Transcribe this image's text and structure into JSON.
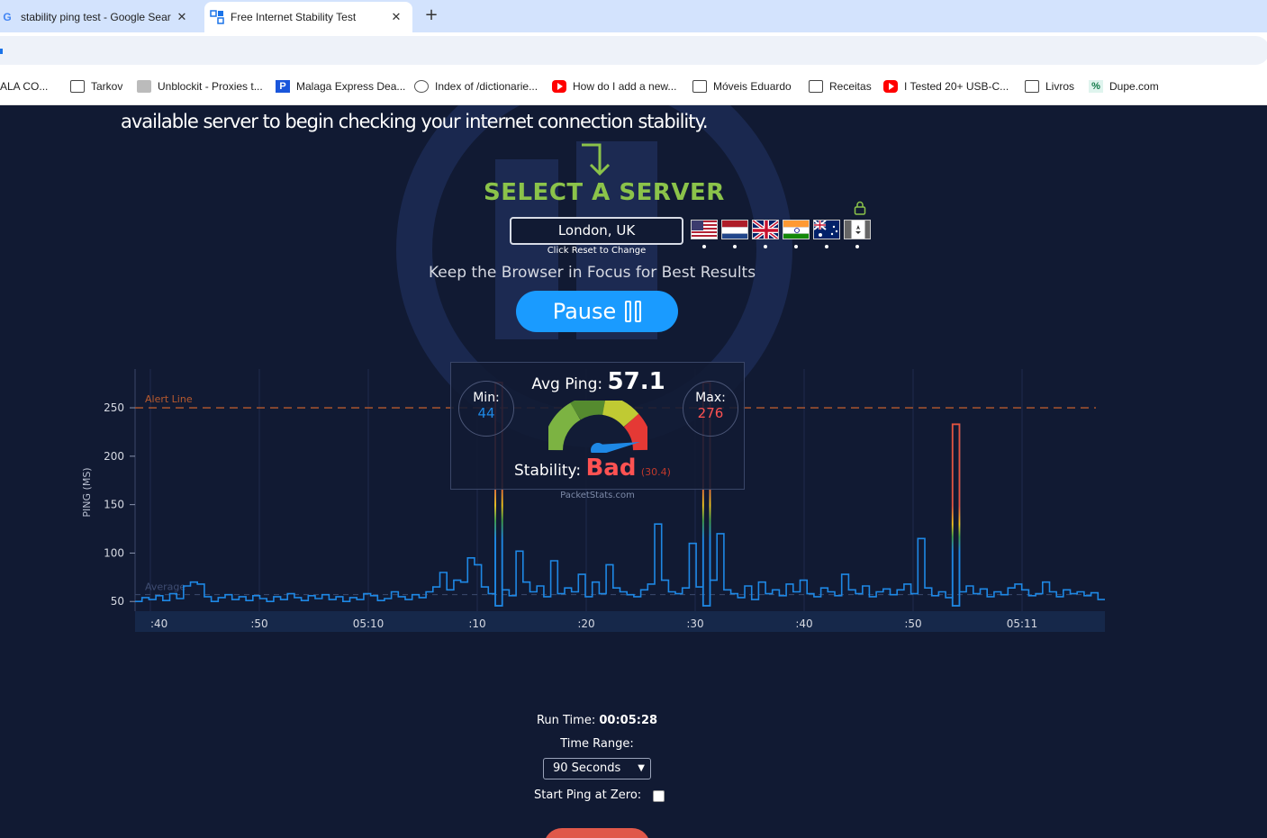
{
  "browser": {
    "tabs": [
      {
        "title": "stability ping test - Google Sear",
        "favicon": "G",
        "active": false
      },
      {
        "title": "Free Internet Stability Test",
        "favicon": "packetstats",
        "active": true
      }
    ],
    "bookmarks": [
      {
        "label": "ALA CO...",
        "icon": "none"
      },
      {
        "label": "Tarkov",
        "icon": "folder-icon"
      },
      {
        "label": "Unblockit - Proxies t...",
        "icon": "book-icon"
      },
      {
        "label": "Malaga Express Dea...",
        "icon": "p-icon"
      },
      {
        "label": "Index of /dictionarie...",
        "icon": "globe-icon"
      },
      {
        "label": "How do I add a new...",
        "icon": "yt-icon"
      },
      {
        "label": "Móveis Eduardo",
        "icon": "folder-icon"
      },
      {
        "label": "Receitas",
        "icon": "folder-icon"
      },
      {
        "label": "I Tested 20+ USB-C...",
        "icon": "yt-icon"
      },
      {
        "label": "Livros",
        "icon": "folder-icon"
      },
      {
        "label": "Dupe.com",
        "icon": "dupe-icon"
      }
    ]
  },
  "page": {
    "intro": "available server to begin checking your internet connection stability.",
    "select_title": "SELECT A SERVER",
    "server": "London, UK",
    "server_hint": "Click Reset to Change",
    "flags": [
      "us",
      "nl",
      "uk",
      "in",
      "au",
      "ca"
    ],
    "focus_hint": "Keep the Browser in Focus for Best Results",
    "pause_label": "Pause",
    "stats": {
      "avg_label": "Avg Ping:",
      "avg_value": "57.1",
      "min_label": "Min:",
      "min_value": "44",
      "max_label": "Max:",
      "max_value": "276",
      "stability_label": "Stability:",
      "stability_value": "Bad",
      "stability_score": "(30.4)",
      "brand": "PacketStats.com"
    },
    "controls": {
      "run_time_label": "Run Time:",
      "run_time_value": "00:05:28",
      "time_range_label": "Time Range:",
      "time_range_value": "90 Seconds",
      "start_zero_label": "Start Ping at Zero:"
    },
    "colors": {
      "accent": "#1a9bff",
      "title_green": "#8bc34a",
      "bad_red": "#ff5252",
      "line_blue": "#1e88e5",
      "alert": "#c0582b"
    }
  },
  "chart_data": {
    "type": "line",
    "ylabel": "PING (MS)",
    "ylim": [
      40,
      290
    ],
    "yticks": [
      50,
      100,
      150,
      200,
      250
    ],
    "xticks": [
      ":40",
      ":50",
      "05:10",
      ":10",
      ":20",
      ":30",
      ":40",
      ":50",
      "05:11"
    ],
    "alert_line": {
      "label": "Alert Line",
      "value": 250
    },
    "average_line": {
      "label": "Average",
      "value": 57.1
    },
    "series": [
      {
        "values": [
          50,
          54,
          52,
          56,
          51,
          58,
          53,
          66,
          70,
          68,
          55,
          50,
          54,
          57,
          52,
          55,
          51,
          56,
          53,
          50,
          55,
          52,
          58,
          54,
          51,
          56,
          53,
          57,
          52,
          55,
          50,
          54,
          52,
          58,
          56,
          51,
          53,
          60,
          55,
          52,
          57,
          54,
          60,
          65,
          80,
          62,
          72,
          70,
          95,
          88,
          65,
          58,
          276,
          62,
          56,
          102,
          70,
          60,
          66,
          55,
          92,
          58,
          64,
          60,
          78,
          55,
          70,
          58,
          88,
          64,
          60,
          57,
          55,
          62,
          68,
          130,
          72,
          60,
          58,
          64,
          110,
          65,
          276,
          72,
          120,
          62,
          58,
          54,
          66,
          52,
          70,
          58,
          62,
          56,
          68,
          60,
          72,
          58,
          55,
          64,
          60,
          56,
          78,
          62,
          58,
          66,
          55,
          60,
          63,
          57,
          62,
          68,
          58,
          115,
          64,
          56,
          60,
          54,
          233,
          60,
          66,
          58,
          63,
          55,
          60,
          57,
          64,
          68,
          62,
          56,
          58,
          70,
          60,
          55,
          62,
          58,
          60,
          56,
          59,
          52
        ]
      }
    ]
  }
}
